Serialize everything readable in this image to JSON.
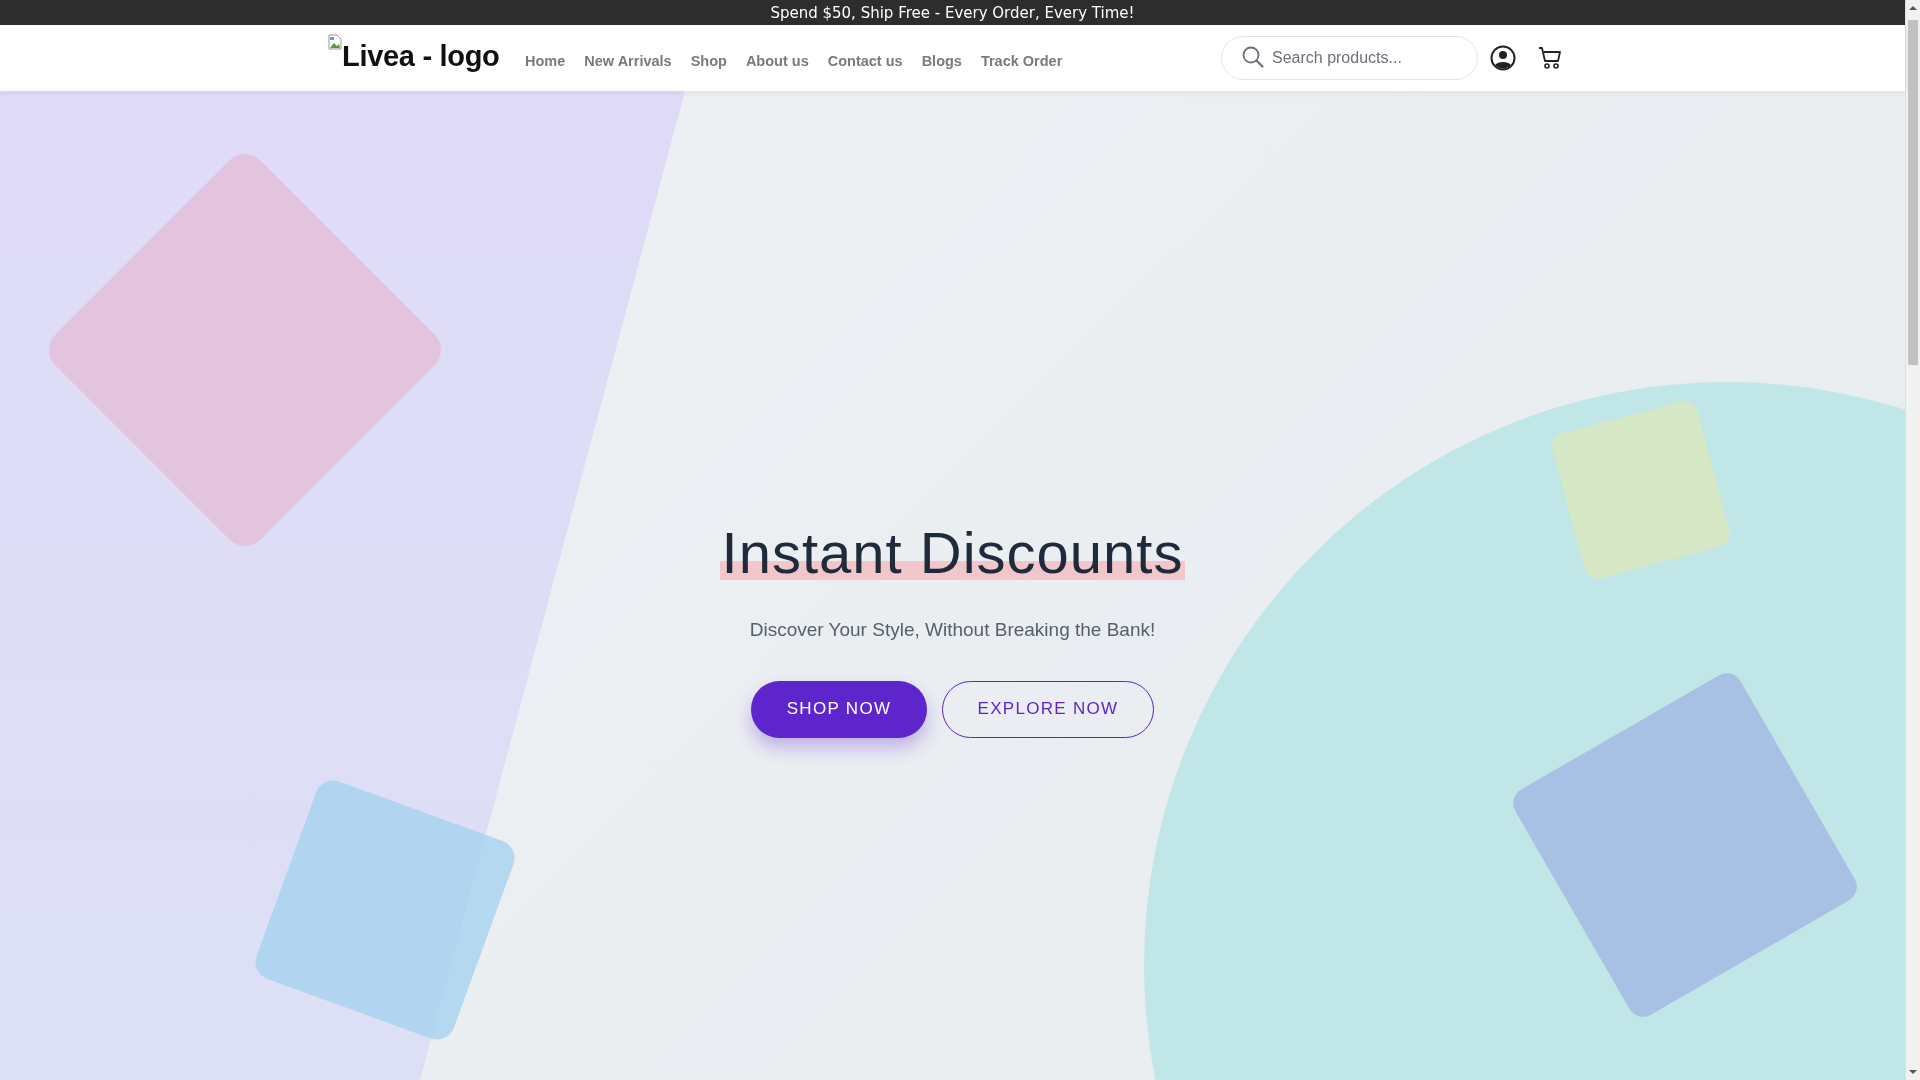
{
  "announcement": "Spend $50, Ship Free - Every Order, Every Time!",
  "header": {
    "logo_alt": "Livea - logo",
    "nav": [
      {
        "label": "Home"
      },
      {
        "label": "New Arrivals"
      },
      {
        "label": "Shop"
      },
      {
        "label": "About us"
      },
      {
        "label": "Contact us"
      },
      {
        "label": "Blogs"
      },
      {
        "label": "Track Order"
      }
    ],
    "search": {
      "placeholder": "Search products..."
    }
  },
  "hero": {
    "title": "Instant Discounts",
    "subtitle": "Discover Your Style, Without Breaking the Bank!",
    "buttons": [
      {
        "label": "SHOP NOW",
        "kind": "primary"
      },
      {
        "label": "EXPLORE NOW",
        "kind": "outline"
      }
    ]
  }
}
